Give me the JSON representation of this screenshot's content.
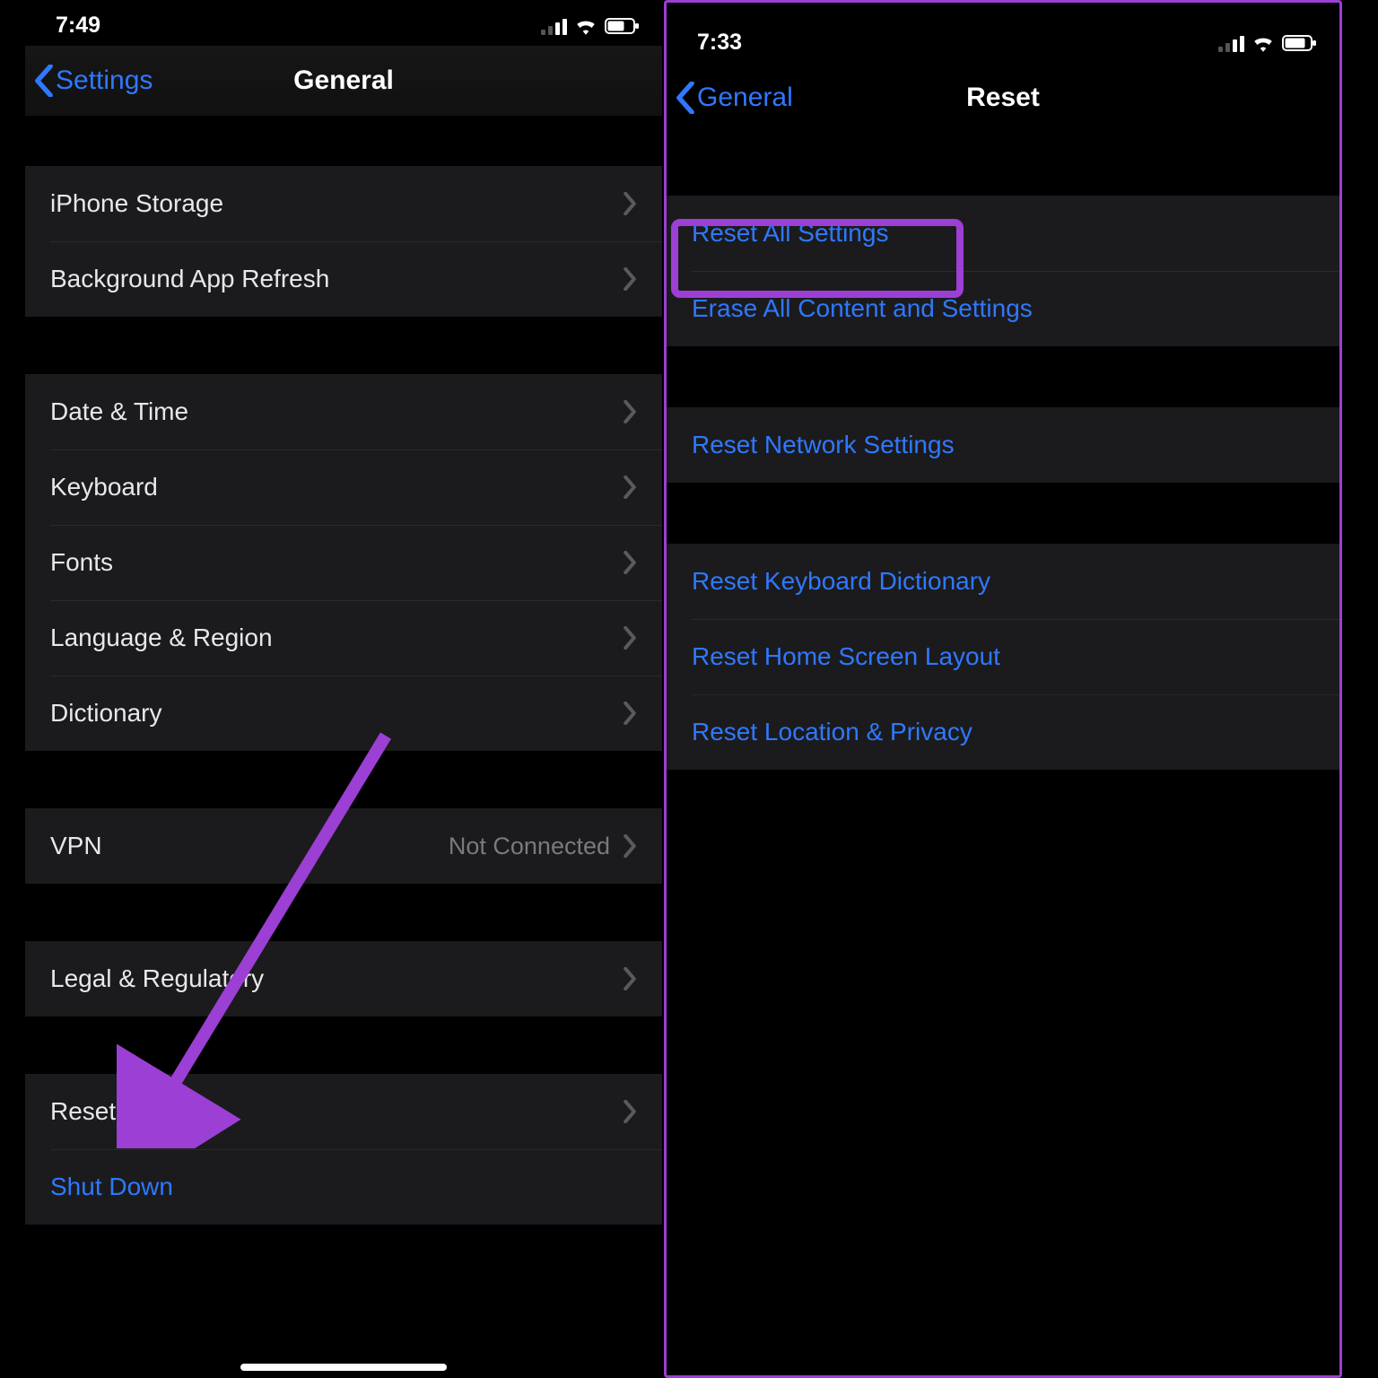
{
  "colors": {
    "accent": "#2f78ff",
    "annotation": "#9c3fd4"
  },
  "left": {
    "status": {
      "time": "7:49"
    },
    "nav": {
      "back": "Settings",
      "title": "General"
    },
    "groups": [
      {
        "rows": [
          {
            "label": "iPhone Storage",
            "chevron": true
          },
          {
            "label": "Background App Refresh",
            "chevron": true
          }
        ]
      },
      {
        "rows": [
          {
            "label": "Date & Time",
            "chevron": true
          },
          {
            "label": "Keyboard",
            "chevron": true
          },
          {
            "label": "Fonts",
            "chevron": true
          },
          {
            "label": "Language & Region",
            "chevron": true
          },
          {
            "label": "Dictionary",
            "chevron": true
          }
        ]
      },
      {
        "rows": [
          {
            "label": "VPN",
            "value": "Not Connected",
            "chevron": true
          }
        ]
      },
      {
        "rows": [
          {
            "label": "Legal & Regulatory",
            "chevron": true
          }
        ]
      },
      {
        "rows": [
          {
            "label": "Reset",
            "chevron": true
          },
          {
            "label": "Shut Down",
            "link": true
          }
        ]
      }
    ]
  },
  "right": {
    "status": {
      "time": "7:33"
    },
    "nav": {
      "back": "General",
      "title": "Reset"
    },
    "groups": [
      {
        "rows": [
          {
            "label": "Reset All Settings",
            "link": true
          },
          {
            "label": "Erase All Content and Settings",
            "link": true
          }
        ]
      },
      {
        "rows": [
          {
            "label": "Reset Network Settings",
            "link": true
          }
        ]
      },
      {
        "rows": [
          {
            "label": "Reset Keyboard Dictionary",
            "link": true
          },
          {
            "label": "Reset Home Screen Layout",
            "link": true
          },
          {
            "label": "Reset Location & Privacy",
            "link": true
          }
        ]
      }
    ]
  }
}
